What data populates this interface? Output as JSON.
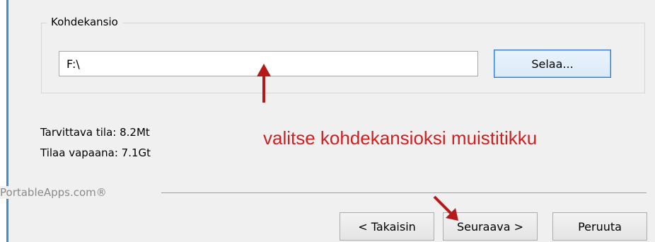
{
  "destination_group": {
    "title": "Kohdekansio",
    "path_value": "F:\\",
    "browse_label": "Selaa..."
  },
  "space_info": {
    "required": "Tarvittava tila: 8.2Mt",
    "free": "Tilaa vapaana: 7.1Gt"
  },
  "annotation": {
    "text": "valitse kohdekansioksi muistitikku",
    "color": "#d21e1e"
  },
  "footer": {
    "brand": "PortableApps.com®"
  },
  "buttons": {
    "back_label": "< Takaisin",
    "next_label": "Seuraava >",
    "cancel_label": "Peruuta"
  },
  "icons": [
    "arrow-up-icon",
    "arrow-down-right-icon"
  ],
  "colors": {
    "accent_border": "#3c8fd6",
    "focus_border": "#2d7dd1"
  }
}
